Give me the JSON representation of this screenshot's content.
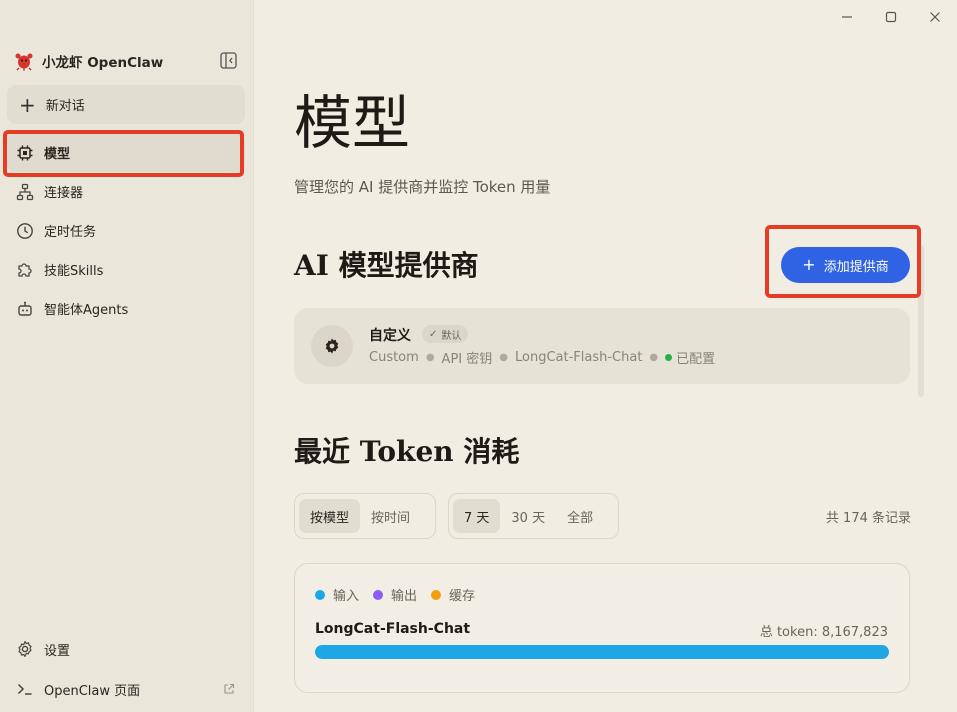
{
  "window": {
    "controls": [
      "minimize-icon",
      "maximize-icon",
      "close-icon"
    ]
  },
  "sidebar": {
    "brand": "小龙虾 OpenClaw",
    "new_chat": "新对话",
    "items": [
      {
        "label": "模型",
        "icon": "chip-icon",
        "active": true
      },
      {
        "label": "连接器",
        "icon": "network-icon"
      },
      {
        "label": "定时任务",
        "icon": "clock-icon"
      },
      {
        "label": "技能Skills",
        "icon": "puzzle-icon"
      },
      {
        "label": "智能体Agents",
        "icon": "robot-icon"
      }
    ],
    "bottom": [
      {
        "label": "设置",
        "icon": "gear-icon"
      },
      {
        "label": "OpenClaw 页面",
        "icon": "terminal-icon"
      }
    ]
  },
  "main": {
    "title": "模型",
    "subtitle": "管理您的 AI 提供商并监控 Token 用量",
    "providers_section": {
      "title": "AI 模型提供商",
      "add_button": "添加提供商"
    },
    "provider": {
      "name": "自定义",
      "badge": "默认",
      "type": "Custom",
      "auth": "API 密钥",
      "model": "LongCat-Flash-Chat",
      "status": "已配置"
    },
    "usage_section": {
      "title": "最近 Token 消耗",
      "group_by": [
        "按模型",
        "按时间"
      ],
      "group_by_selected": "按模型",
      "ranges": [
        "7 天",
        "30 天",
        "全部"
      ],
      "range_selected": "7 天",
      "record_count": "共 174 条记录",
      "legend": [
        {
          "label": "输入",
          "color": "#1ea7e4"
        },
        {
          "label": "输出",
          "color": "#8b5cf6"
        },
        {
          "label": "缓存",
          "color": "#f59e0b"
        }
      ],
      "rows": [
        {
          "model": "LongCat-Flash-Chat",
          "total": "总 token: 8,167,823",
          "input_fraction": 1.0,
          "output_fraction": 0.0,
          "cache_fraction": 0.0
        }
      ]
    },
    "colors": {
      "accent": "#2f63e3",
      "highlight": "#e63b26",
      "status_ok": "#22b24c"
    }
  }
}
